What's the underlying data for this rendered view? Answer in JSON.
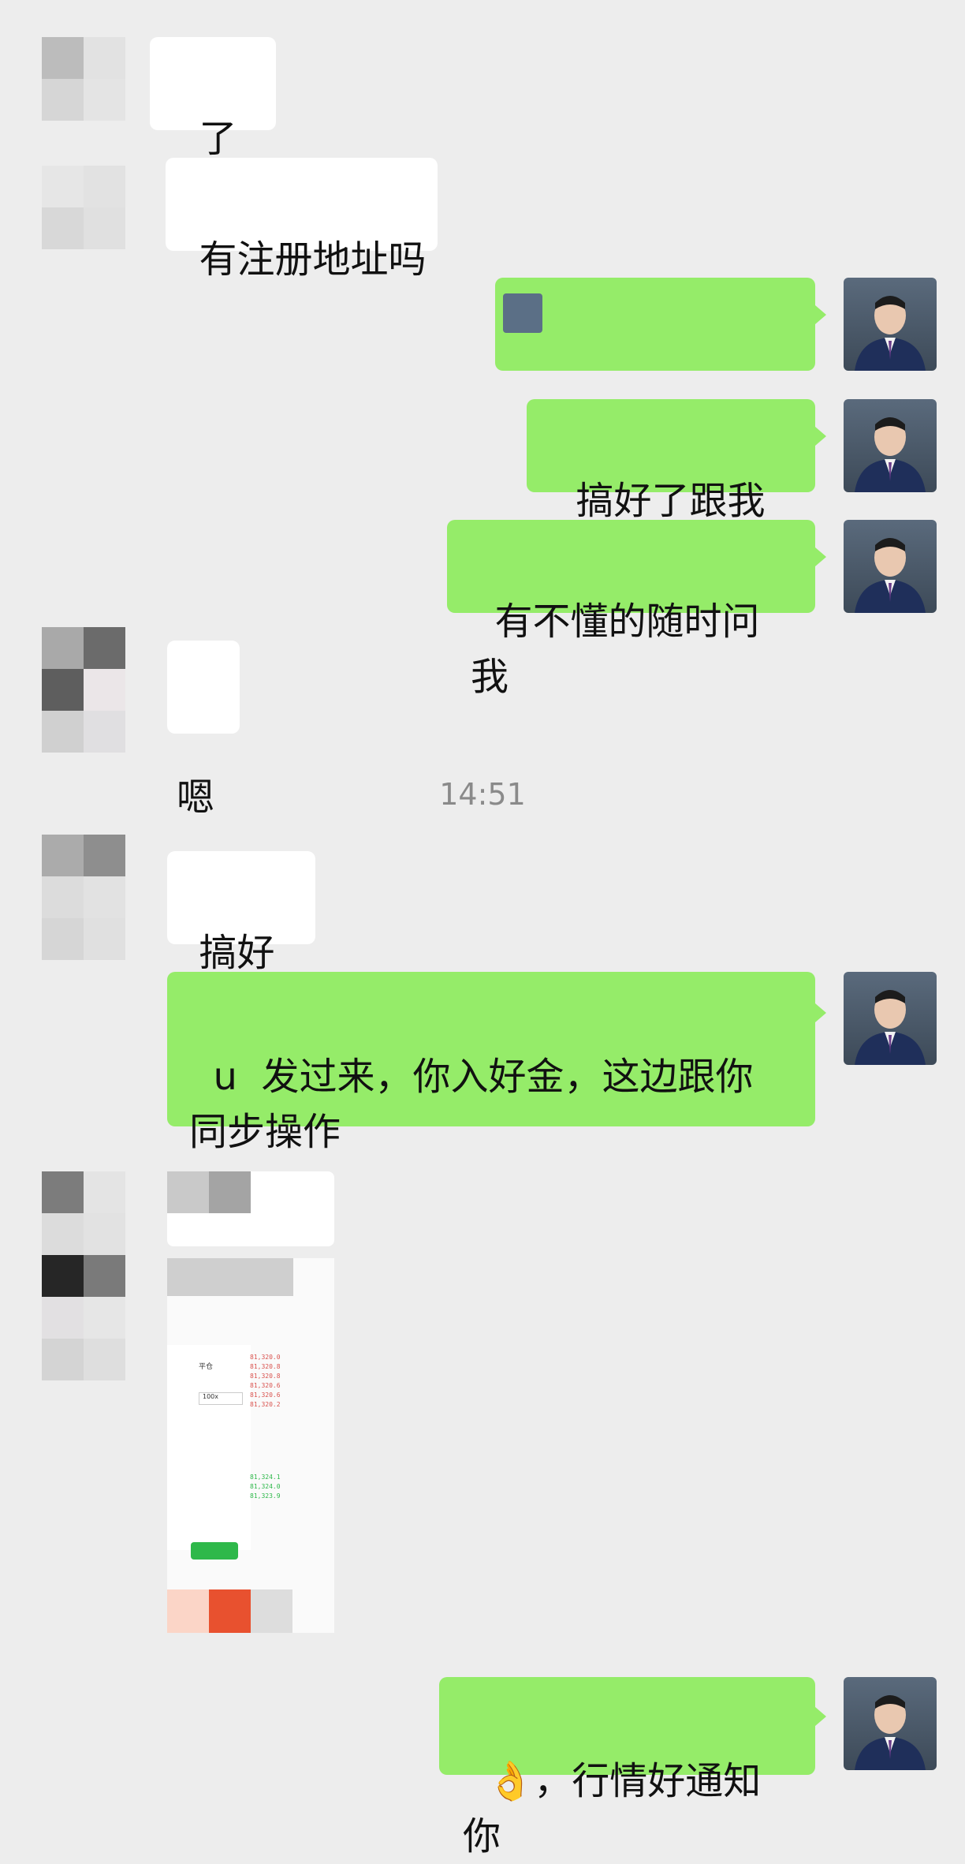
{
  "chat": {
    "timestamp": "14:51",
    "messages": [
      {
        "from": "other",
        "text": "了解"
      },
      {
        "from": "other",
        "text": "有注册地址吗"
      },
      {
        "from": "self",
        "text": ""
      },
      {
        "from": "self",
        "text": "搞好了跟我说"
      },
      {
        "from": "self",
        "text": "有不懂的随时问我"
      },
      {
        "from": "other",
        "text": "嗯"
      },
      {
        "from": "other",
        "text": "搞好了"
      },
      {
        "from": "self",
        "text": "u  发过来，你入好金，这边跟你\n同步操作"
      },
      {
        "from": "other",
        "text": "",
        "kind": "image"
      },
      {
        "from": "self",
        "text": "👌，行情好通知你"
      }
    ],
    "image_prices": [
      "81,320.0",
      "81,320.8",
      "81,320.8",
      "81,320.6",
      "81,320.6",
      "81,320.2",
      "81,324.1",
      "81,324.0",
      "81,323.9"
    ],
    "image_labels": {
      "tab": "平仓",
      "leverage": "100x"
    }
  },
  "colors": {
    "bg": "#ededed",
    "self_bubble": "#95ec69",
    "other_bubble": "#ffffff",
    "timestamp": "#8a8a8a"
  }
}
